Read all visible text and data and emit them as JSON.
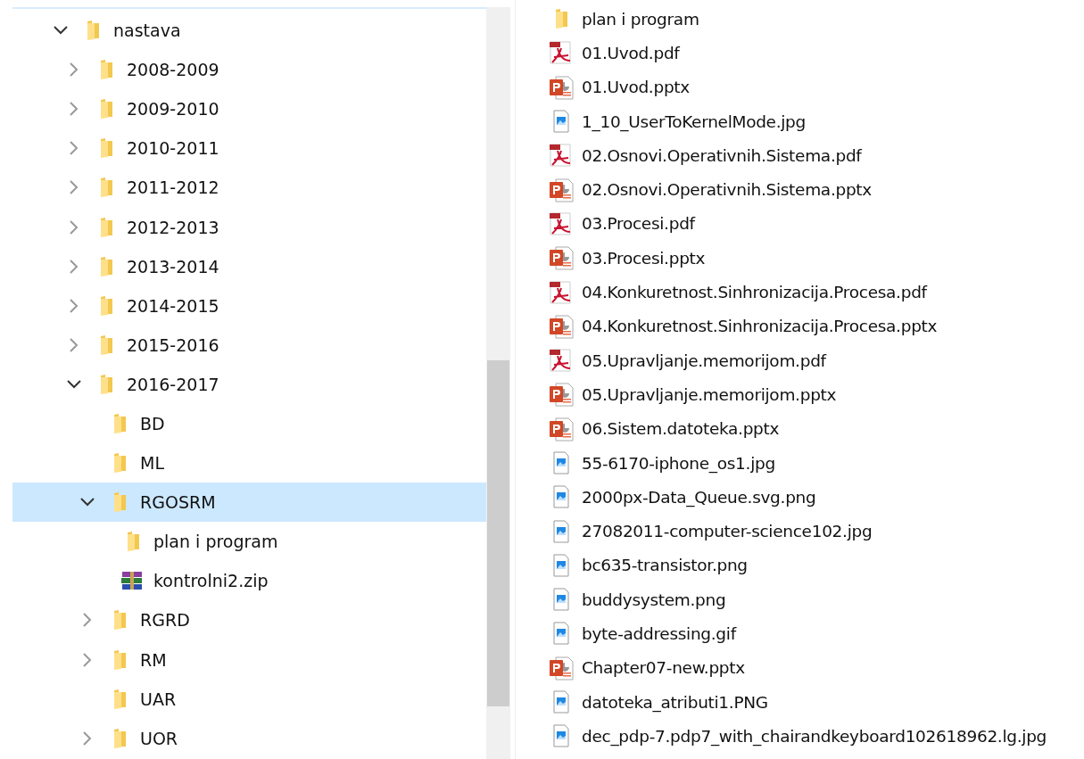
{
  "tree": [
    {
      "label": "nastava",
      "kind": "folder",
      "expandable": true,
      "expanded": true,
      "selected": false,
      "children": [
        {
          "label": "2008-2009",
          "kind": "folder",
          "expandable": true,
          "expanded": false,
          "selected": false
        },
        {
          "label": "2009-2010",
          "kind": "folder",
          "expandable": true,
          "expanded": false,
          "selected": false
        },
        {
          "label": "2010-2011",
          "kind": "folder",
          "expandable": true,
          "expanded": false,
          "selected": false
        },
        {
          "label": "2011-2012",
          "kind": "folder",
          "expandable": true,
          "expanded": false,
          "selected": false
        },
        {
          "label": "2012-2013",
          "kind": "folder",
          "expandable": true,
          "expanded": false,
          "selected": false
        },
        {
          "label": "2013-2014",
          "kind": "folder",
          "expandable": true,
          "expanded": false,
          "selected": false
        },
        {
          "label": "2014-2015",
          "kind": "folder",
          "expandable": true,
          "expanded": false,
          "selected": false
        },
        {
          "label": "2015-2016",
          "kind": "folder",
          "expandable": true,
          "expanded": false,
          "selected": false
        },
        {
          "label": "2016-2017",
          "kind": "folder",
          "expandable": true,
          "expanded": true,
          "selected": false,
          "children": [
            {
              "label": "BD",
              "kind": "folder",
              "expandable": false,
              "selected": false
            },
            {
              "label": "ML",
              "kind": "folder",
              "expandable": false,
              "selected": false
            },
            {
              "label": "RGOSRM",
              "kind": "folder",
              "expandable": true,
              "expanded": true,
              "selected": true,
              "children": [
                {
                  "label": "plan i program",
                  "kind": "folder",
                  "expandable": false,
                  "selected": false
                },
                {
                  "label": "kontrolni2.zip",
                  "kind": "archive",
                  "expandable": false,
                  "selected": false
                }
              ]
            },
            {
              "label": "RGRD",
              "kind": "folder",
              "expandable": true,
              "expanded": false,
              "selected": false
            },
            {
              "label": "RM",
              "kind": "folder",
              "expandable": true,
              "expanded": false,
              "selected": false
            },
            {
              "label": "UAR",
              "kind": "folder",
              "expandable": false,
              "selected": false
            },
            {
              "label": "UOR",
              "kind": "folder",
              "expandable": true,
              "expanded": false,
              "selected": false
            }
          ]
        }
      ]
    }
  ],
  "files": [
    {
      "name": "plan i program",
      "kind": "folder"
    },
    {
      "name": "01.Uvod.pdf",
      "kind": "pdf"
    },
    {
      "name": "01.Uvod.pptx",
      "kind": "pptx"
    },
    {
      "name": "1_10_UserToKernelMode.jpg",
      "kind": "image"
    },
    {
      "name": "02.Osnovi.Operativnih.Sistema.pdf",
      "kind": "pdf"
    },
    {
      "name": "02.Osnovi.Operativnih.Sistema.pptx",
      "kind": "pptx"
    },
    {
      "name": "03.Procesi.pdf",
      "kind": "pdf"
    },
    {
      "name": "03.Procesi.pptx",
      "kind": "pptx"
    },
    {
      "name": "04.Konkuretnost.Sinhronizacija.Procesa.pdf",
      "kind": "pdf"
    },
    {
      "name": "04.Konkuretnost.Sinhronizacija.Procesa.pptx",
      "kind": "pptx"
    },
    {
      "name": "05.Upravljanje.memorijom.pdf",
      "kind": "pdf"
    },
    {
      "name": "05.Upravljanje.memorijom.pptx",
      "kind": "pptx"
    },
    {
      "name": "06.Sistem.datoteka.pptx",
      "kind": "pptx"
    },
    {
      "name": "55-6170-iphone_os1.jpg",
      "kind": "image"
    },
    {
      "name": "2000px-Data_Queue.svg.png",
      "kind": "image"
    },
    {
      "name": "27082011-computer-science102.jpg",
      "kind": "image"
    },
    {
      "name": "bc635-transistor.png",
      "kind": "image"
    },
    {
      "name": "buddysystem.png",
      "kind": "image"
    },
    {
      "name": "byte-addressing.gif",
      "kind": "image"
    },
    {
      "name": "Chapter07-new.pptx",
      "kind": "pptx"
    },
    {
      "name": "datoteka_atributi1.PNG",
      "kind": "image"
    },
    {
      "name": "dec_pdp-7.pdp7_with_chairandkeyboard102618962.lg.jpg",
      "kind": "image"
    }
  ]
}
